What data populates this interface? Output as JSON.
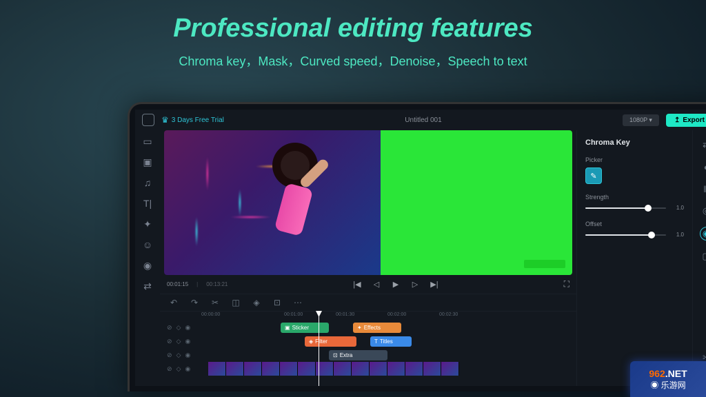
{
  "hero": {
    "title": "Professional editing features",
    "subtitle": "Chroma key，Mask，Curved speed，Denoise，Speech to text"
  },
  "topbar": {
    "trial": "3 Days Free Trial",
    "project_title": "Untitled 001",
    "resolution": "1080P ▾",
    "export": "Export"
  },
  "playbar": {
    "current": "00:01:15",
    "total": "00:13:21"
  },
  "ruler": {
    "t0": "00:00:00",
    "t1": "00:01:00",
    "t2": "00:01:30",
    "t3": "00:02:00",
    "t4": "00:02:30"
  },
  "clips": {
    "sticker": "Sticker",
    "effects": "Effects",
    "filter": "Filter",
    "titles": "Titles",
    "extra": "Extra"
  },
  "panel": {
    "title": "Chroma Key",
    "picker": "Picker",
    "strength_label": "Strength",
    "strength_val": "1.0",
    "offset_label": "Offset",
    "offset_val": "1.0"
  },
  "badge": {
    "line1a": "962",
    "line1b": ".NET",
    "line2": "◉ 乐游网"
  }
}
